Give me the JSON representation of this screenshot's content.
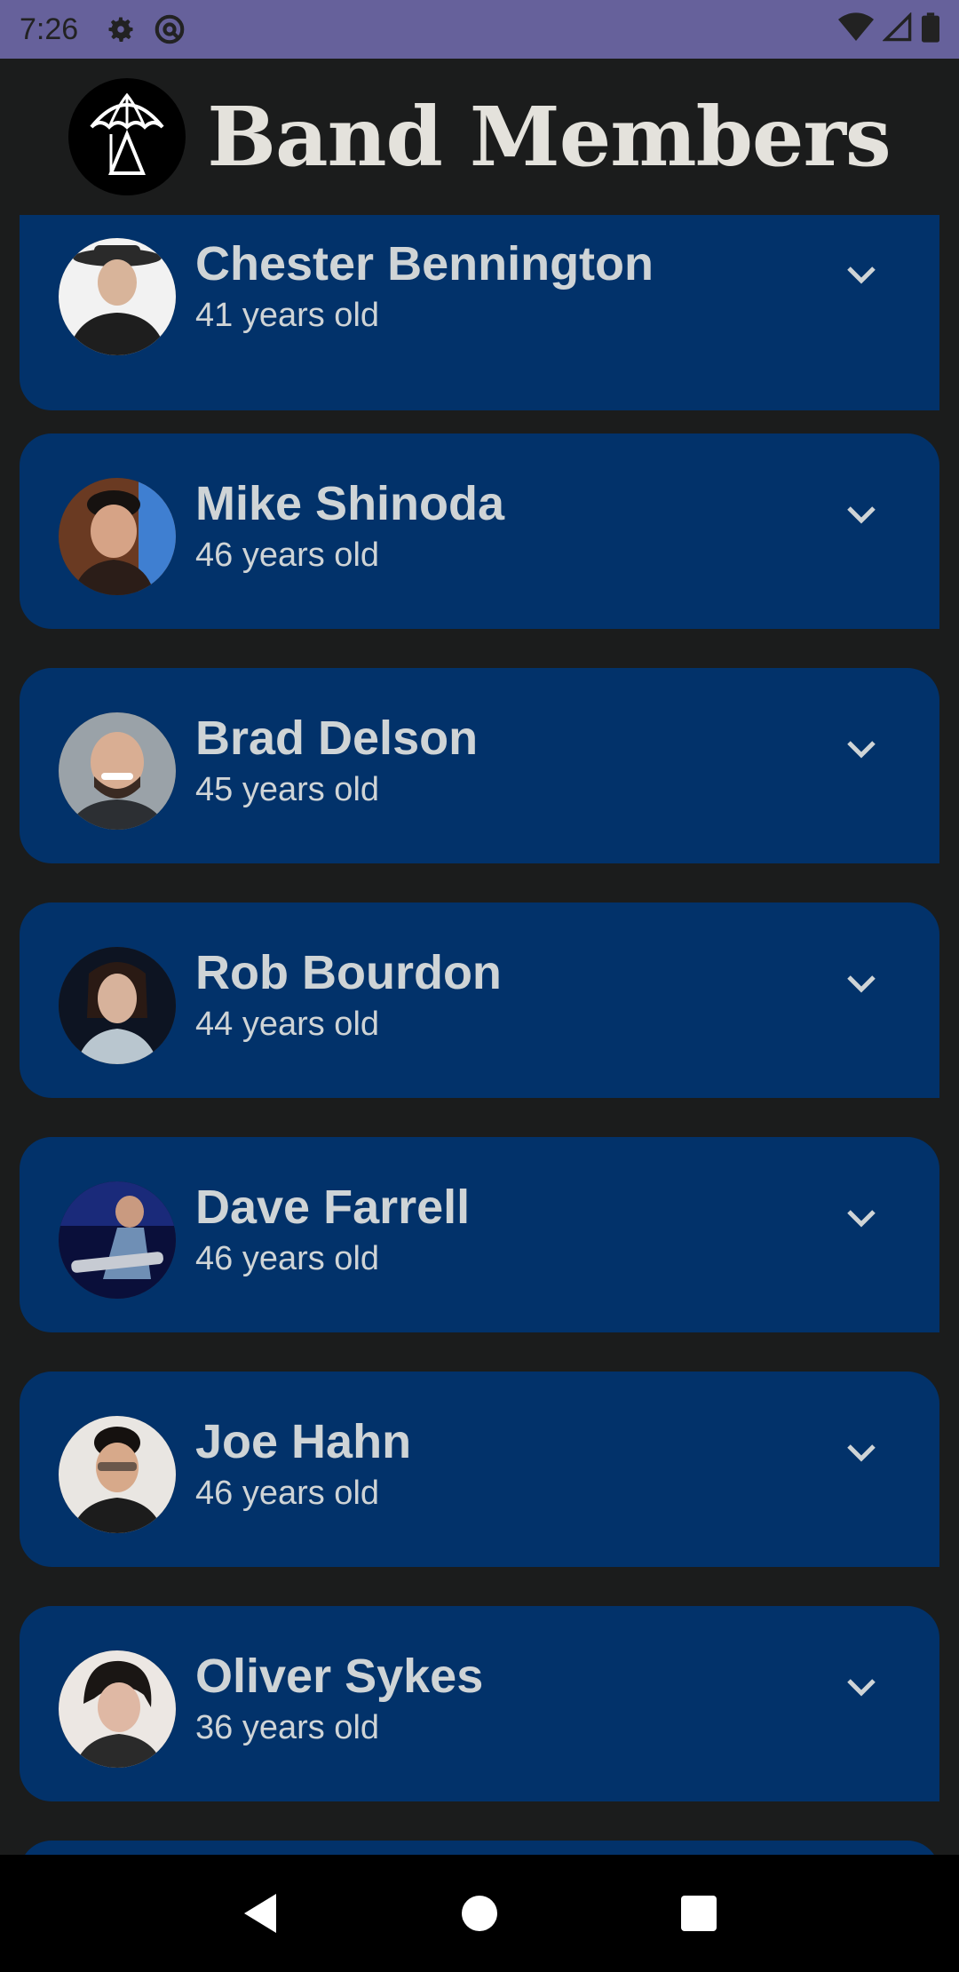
{
  "status": {
    "time": "7:26"
  },
  "app": {
    "title": "Band Members"
  },
  "members": [
    {
      "name": "Chester Bennington",
      "age": "41 years old"
    },
    {
      "name": "Mike Shinoda",
      "age": "46 years old"
    },
    {
      "name": "Brad Delson",
      "age": "45 years old"
    },
    {
      "name": "Rob Bourdon",
      "age": "44 years old"
    },
    {
      "name": "Dave Farrell",
      "age": "46 years old"
    },
    {
      "name": "Joe Hahn",
      "age": "46 years old"
    },
    {
      "name": "Oliver Sykes",
      "age": "36 years old"
    }
  ],
  "colors": {
    "status_bar": "#66619b",
    "background": "#1b1c1c",
    "card": "#02326a",
    "card_text": "#cfd4d6",
    "title": "#e4e2dc"
  },
  "icons": {
    "status": [
      "gear-icon",
      "at-sign-icon",
      "wifi-icon",
      "signal-icon",
      "battery-icon"
    ],
    "card": "chevron-down-icon",
    "nav": [
      "back-icon",
      "home-icon",
      "recents-icon"
    ]
  }
}
